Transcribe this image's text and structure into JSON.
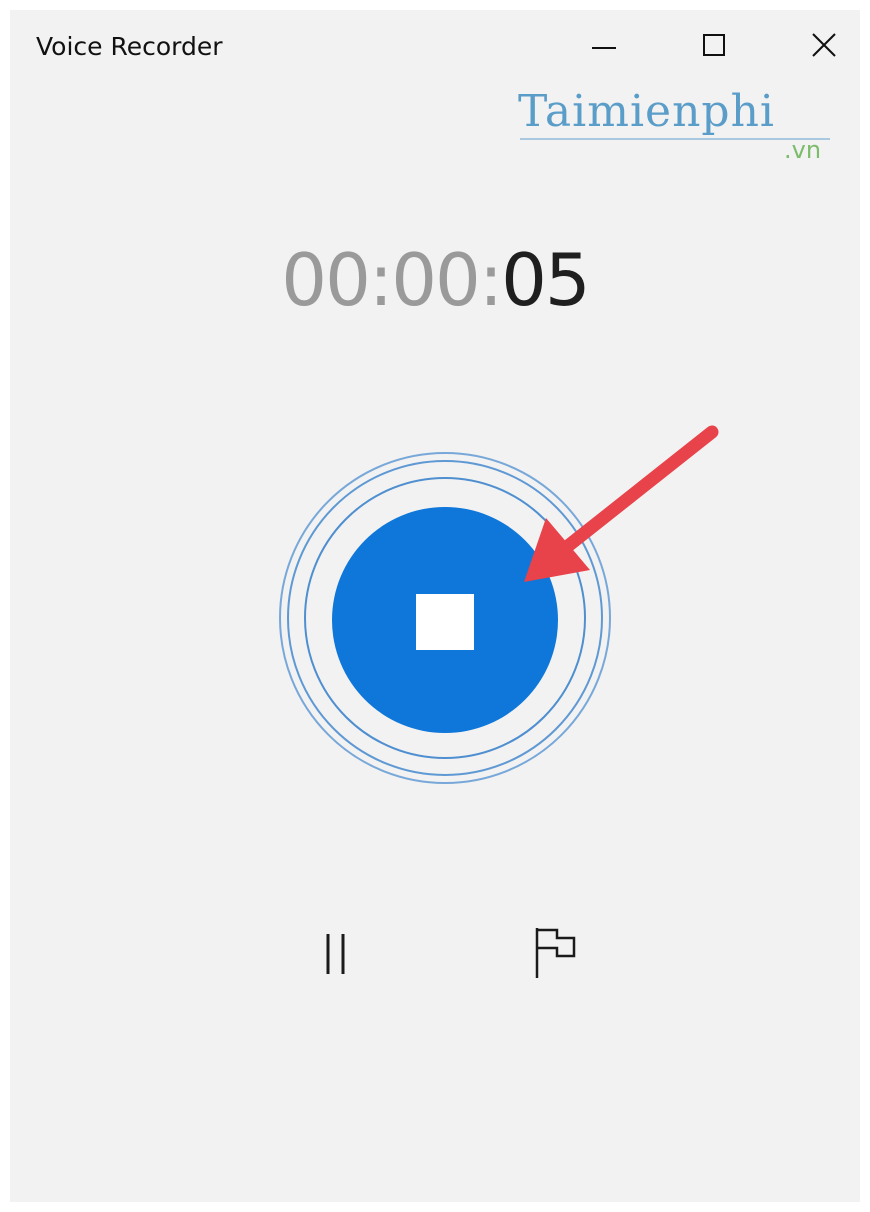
{
  "window": {
    "title": "Voice Recorder",
    "controls": {
      "minimize": "minimize-icon",
      "maximize": "maximize-icon",
      "close": "close-icon"
    }
  },
  "watermark": {
    "brand": "Taimienphi",
    "suffix": ".vn"
  },
  "timer": {
    "hours": "00",
    "sep1": ":",
    "minutes": "00",
    "sep2": ":",
    "seconds": "05"
  },
  "recorder": {
    "state": "recording",
    "main_button_icon": "stop-icon"
  },
  "controls": {
    "pause_icon": "pause-icon",
    "marker_icon": "flag-icon"
  },
  "colors": {
    "accent": "#0f77d9",
    "rings": "#4f8fd0",
    "background": "#f2f2f2",
    "annotation_arrow": "#e8424a",
    "watermark_blue": "#5b9dc9",
    "watermark_green": "#7cbc6a"
  }
}
